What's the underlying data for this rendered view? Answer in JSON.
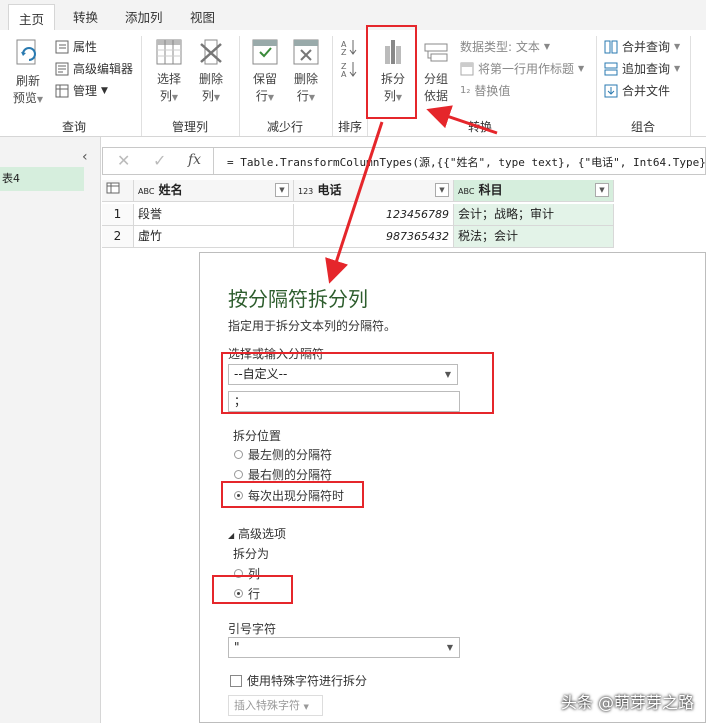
{
  "tabs": [
    "主页",
    "转换",
    "添加列",
    "视图"
  ],
  "ribbon": {
    "query": {
      "refresh": "刷新",
      "preview": "预览",
      "properties": "属性",
      "advanced_editor": "高级编辑器",
      "manage": "管理",
      "label": "查询"
    },
    "manage_columns": {
      "choose": "选择",
      "choose2": "列",
      "remove": "删除",
      "remove2": "列",
      "label": "管理列"
    },
    "reduce_rows": {
      "keep": "保留",
      "keep2": "行",
      "remove": "删除",
      "remove2": "行",
      "label": "减少行"
    },
    "sort": {
      "label": "排序"
    },
    "transform": {
      "split": "拆分",
      "split2": "列",
      "group": "分组",
      "group2": "依据",
      "data_type": "数据类型: 文本",
      "first_row_header": "将第一行用作标题",
      "replace": "替换值",
      "label": "转换"
    },
    "combine": {
      "merge": "合并查询",
      "append": "追加查询",
      "combine_files": "合并文件",
      "label": "组合"
    }
  },
  "left_pane": {
    "item": "表4"
  },
  "formula_bar": {
    "fx": "fx",
    "text": "= Table.TransformColumnTypes(源,{{\"姓名\", type text}, {\"电话\", Int64.Type},"
  },
  "table": {
    "headers": [
      {
        "type": "ABC",
        "name": "姓名"
      },
      {
        "type": "123",
        "name": "电话"
      },
      {
        "type": "ABC",
        "name": "科目"
      }
    ],
    "rows": [
      {
        "index": "1",
        "name": "段誉",
        "phone": "123456789",
        "subject": "会计；战略；审计"
      },
      {
        "index": "2",
        "name": "虚竹",
        "phone": "987365432",
        "subject": "税法；会计"
      }
    ]
  },
  "dialog": {
    "title": "按分隔符拆分列",
    "subtitle": "指定用于拆分文本列的分隔符。",
    "delimiter_label": "选择或输入分隔符",
    "delimiter_select": "--自定义--",
    "delimiter_value": "；",
    "split_at_label": "拆分位置",
    "split_at_options": [
      "最左侧的分隔符",
      "最右侧的分隔符",
      "每次出现分隔符时"
    ],
    "advanced_label": "高级选项",
    "split_into_label": "拆分为",
    "split_into_options": [
      "列",
      "行"
    ],
    "quote_label": "引号字符",
    "quote_value": "\"",
    "special_chars_label": "使用特殊字符进行拆分",
    "insert_special_button": "插入特殊字符"
  },
  "watermark": "头条 @萌芽芽之路",
  "colors": {
    "accent_red": "#e5262b",
    "selected_column": "#e3f3e8",
    "title_green": "#2d5d2d"
  }
}
